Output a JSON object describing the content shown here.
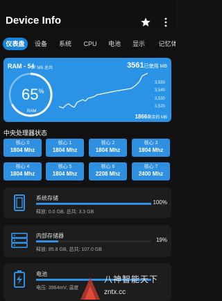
{
  "app": {
    "title": "Device Info"
  },
  "tabs": [
    {
      "label": "仪表盘",
      "active": true
    },
    {
      "label": "设备"
    },
    {
      "label": "系统"
    },
    {
      "label": "CPU"
    },
    {
      "label": "电池"
    },
    {
      "label": "显示"
    },
    {
      "label": "记忆体"
    }
  ],
  "ram": {
    "label": "RAM - 54",
    "total_text": "27 MB 总共",
    "used_value": "3561",
    "used_unit": "已使用 MB",
    "free_value": "1866",
    "free_unit": "剩余的 MB",
    "percent": "65",
    "percent_symbol": "%",
    "gauge_label": "RAM",
    "y_ticks": [
      "3,550",
      "3,540",
      "3,530",
      "3,520"
    ]
  },
  "cpu": {
    "section_title": "中央处理器状态",
    "cores": [
      {
        "name": "核心 0",
        "freq": "1804 Mhz"
      },
      {
        "name": "核心 1",
        "freq": "1804 Mhz"
      },
      {
        "name": "核心 2",
        "freq": "1804 Mhz"
      },
      {
        "name": "核心 3",
        "freq": "1804 Mhz"
      },
      {
        "name": "核心 4",
        "freq": "1804 Mhz"
      },
      {
        "name": "核心 5",
        "freq": "1804 Mhz"
      },
      {
        "name": "核心 6",
        "freq": "2208 Mhz"
      },
      {
        "name": "核心 7",
        "freq": "2400 Mhz"
      }
    ]
  },
  "storage": [
    {
      "title": "系统存储",
      "percent": "100%",
      "detail": "释放: 0.0 GB,  总共: 3.3 GB",
      "fill": 1.0
    },
    {
      "title": "内部存储器",
      "percent": "19%",
      "detail": "释放: 85.8 GB,  总共: 107.0 GB",
      "fill": 0.19
    }
  ],
  "battery": {
    "title": "电池",
    "detail": "电压: 3964mV,  温度"
  },
  "watermark": {
    "line1": "八神智能天下",
    "line2": "zntx.cc"
  },
  "colors": {
    "accent": "#2f8fe0",
    "ram_card": "#2b93e6",
    "background": "#121212",
    "card": "#1d1d1d"
  }
}
